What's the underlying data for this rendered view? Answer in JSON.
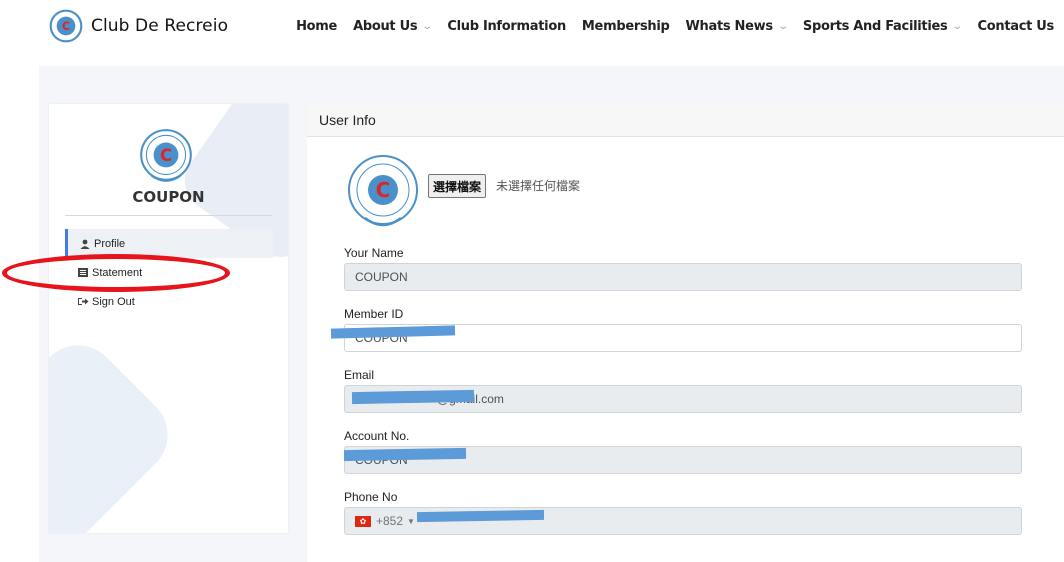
{
  "brand": {
    "name": "Club De Recreio"
  },
  "nav": {
    "items": [
      {
        "label": "Home",
        "dropdown": false
      },
      {
        "label": "About Us",
        "dropdown": true
      },
      {
        "label": "Club Information",
        "dropdown": false
      },
      {
        "label": "Membership",
        "dropdown": false
      },
      {
        "label": "Whats News",
        "dropdown": true
      },
      {
        "label": "Sports And Facilities",
        "dropdown": true
      },
      {
        "label": "Contact Us",
        "dropdown": false
      }
    ],
    "chevron": "⌄"
  },
  "sidebar": {
    "member_name": "COUPON",
    "menu": [
      {
        "label": "Profile",
        "icon": "user-icon",
        "active": true
      },
      {
        "label": "Statement",
        "icon": "list-icon",
        "active": false
      },
      {
        "label": "Sign Out",
        "icon": "sign-out-icon",
        "active": false
      }
    ]
  },
  "user_info": {
    "title": "User Info",
    "file_button_label": "選擇檔案",
    "file_status": "未選擇任何檔案",
    "fields": {
      "name": {
        "label": "Your Name",
        "value": "COUPON"
      },
      "member_id": {
        "label": "Member ID",
        "value": "COUPON"
      },
      "email": {
        "label": "Email",
        "value": "@gmail.com"
      },
      "account_no": {
        "label": "Account No.",
        "value": "COUPON"
      },
      "phone": {
        "label": "Phone No",
        "country_code": "+852"
      }
    }
  },
  "colors": {
    "accent": "#3f7ee0",
    "redaction": "#5c9ad8",
    "annotation": "#e8141b",
    "logo_blue": "#4a90c9",
    "logo_red": "#d9262a"
  }
}
